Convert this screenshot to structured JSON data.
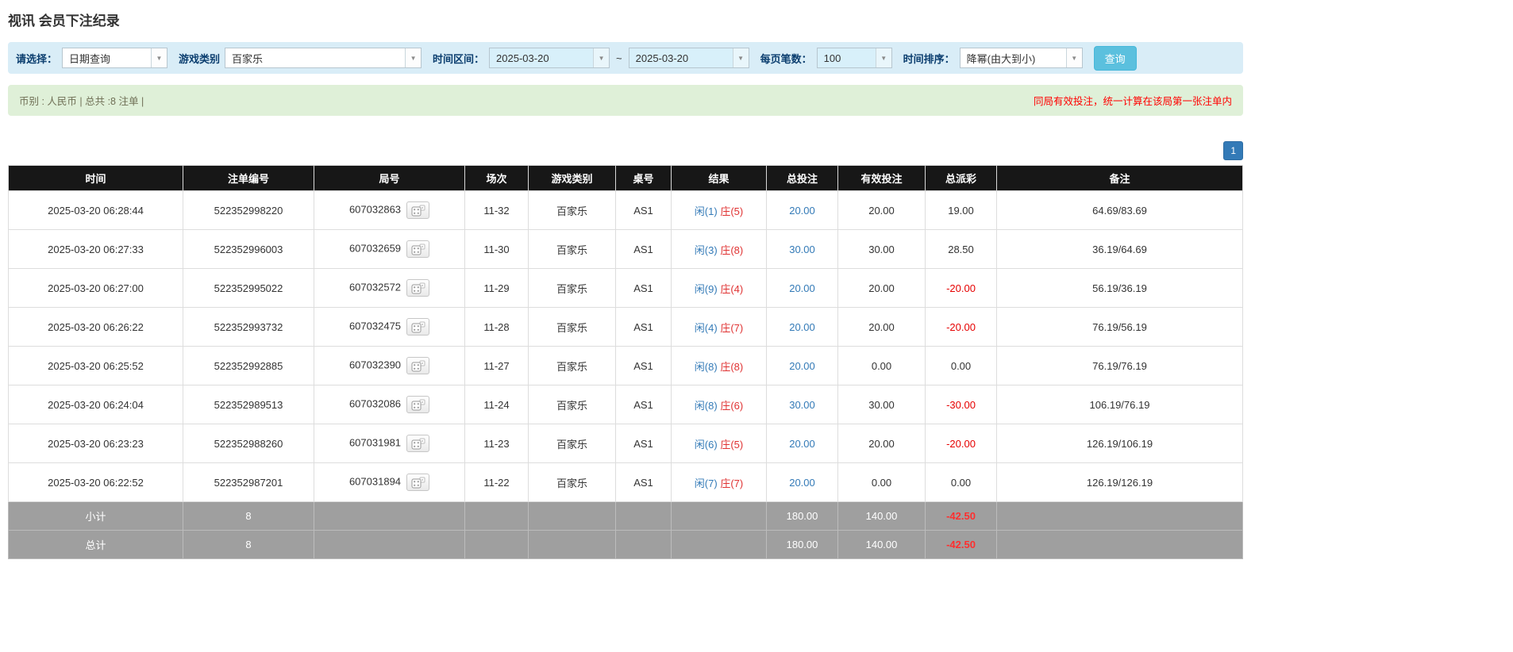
{
  "page": {
    "title": "视讯 会员下注纪录"
  },
  "filters": {
    "select_label": "请选择：",
    "select_value": "日期查询",
    "game_type_label": "游戏类别",
    "game_type_value": "百家乐",
    "date_range_label": "时间区间：",
    "date_from": "2025-03-20",
    "date_separator": "~",
    "date_to": "2025-03-20",
    "page_size_label": "每页笔数：",
    "page_size_value": "100",
    "sort_label": "时间排序：",
    "sort_value": "降幂(由大到小)",
    "search_button": "查询"
  },
  "info_bar": {
    "left": "币别 : 人民币 | 总共 :8 注单 |",
    "right": "同局有效投注，统一计算在该局第一张注单内"
  },
  "pagination": {
    "current": "1"
  },
  "icons": {
    "combo_arrow": "chevron-down-icon",
    "round_detail": "dice-icon"
  },
  "colors": {
    "accent_blue": "#337ab7",
    "player_blue": "#337ab7",
    "banker_red": "#e03333",
    "negative_red": "#e60000",
    "filter_bar_bg": "#d9edf7",
    "info_bar_bg": "#dff0d8",
    "table_header_bg": "#171717",
    "summary_row_bg": "#9f9f9f",
    "search_button_bg": "#5bc0de"
  },
  "table": {
    "headers": [
      "时间",
      "注单编号",
      "局号",
      "场次",
      "游戏类别",
      "桌号",
      "结果",
      "总投注",
      "有效投注",
      "总派彩",
      "备注"
    ],
    "rows": [
      {
        "time": "2025-03-20 06:28:44",
        "bet_id": "522352998220",
        "round": "607032863",
        "session": "11-32",
        "game": "百家乐",
        "table_no": "AS1",
        "result_player": "闲(1)",
        "result_banker": "庄(5)",
        "total_bet": "20.00",
        "valid_bet": "20.00",
        "payout": "19.00",
        "note": "64.69/83.69"
      },
      {
        "time": "2025-03-20 06:27:33",
        "bet_id": "522352996003",
        "round": "607032659",
        "session": "11-30",
        "game": "百家乐",
        "table_no": "AS1",
        "result_player": "闲(3)",
        "result_banker": "庄(8)",
        "total_bet": "30.00",
        "valid_bet": "30.00",
        "payout": "28.50",
        "note": "36.19/64.69"
      },
      {
        "time": "2025-03-20 06:27:00",
        "bet_id": "522352995022",
        "round": "607032572",
        "session": "11-29",
        "game": "百家乐",
        "table_no": "AS1",
        "result_player": "闲(9)",
        "result_banker": "庄(4)",
        "total_bet": "20.00",
        "valid_bet": "20.00",
        "payout": "-20.00",
        "note": "56.19/36.19"
      },
      {
        "time": "2025-03-20 06:26:22",
        "bet_id": "522352993732",
        "round": "607032475",
        "session": "11-28",
        "game": "百家乐",
        "table_no": "AS1",
        "result_player": "闲(4)",
        "result_banker": "庄(7)",
        "total_bet": "20.00",
        "valid_bet": "20.00",
        "payout": "-20.00",
        "note": "76.19/56.19"
      },
      {
        "time": "2025-03-20 06:25:52",
        "bet_id": "522352992885",
        "round": "607032390",
        "session": "11-27",
        "game": "百家乐",
        "table_no": "AS1",
        "result_player": "闲(8)",
        "result_banker": "庄(8)",
        "total_bet": "20.00",
        "valid_bet": "0.00",
        "payout": "0.00",
        "note": "76.19/76.19"
      },
      {
        "time": "2025-03-20 06:24:04",
        "bet_id": "522352989513",
        "round": "607032086",
        "session": "11-24",
        "game": "百家乐",
        "table_no": "AS1",
        "result_player": "闲(8)",
        "result_banker": "庄(6)",
        "total_bet": "30.00",
        "valid_bet": "30.00",
        "payout": "-30.00",
        "note": "106.19/76.19"
      },
      {
        "time": "2025-03-20 06:23:23",
        "bet_id": "522352988260",
        "round": "607031981",
        "session": "11-23",
        "game": "百家乐",
        "table_no": "AS1",
        "result_player": "闲(6)",
        "result_banker": "庄(5)",
        "total_bet": "20.00",
        "valid_bet": "20.00",
        "payout": "-20.00",
        "note": "126.19/106.19"
      },
      {
        "time": "2025-03-20 06:22:52",
        "bet_id": "522352987201",
        "round": "607031894",
        "session": "11-22",
        "game": "百家乐",
        "table_no": "AS1",
        "result_player": "闲(7)",
        "result_banker": "庄(7)",
        "total_bet": "20.00",
        "valid_bet": "0.00",
        "payout": "0.00",
        "note": "126.19/126.19"
      }
    ],
    "subtotal": {
      "label": "小计",
      "count": "8",
      "total_bet": "180.00",
      "valid_bet": "140.00",
      "payout": "-42.50",
      "note": ""
    },
    "total": {
      "label": "总计",
      "count": "8",
      "total_bet": "180.00",
      "valid_bet": "140.00",
      "payout": "-42.50",
      "note": ""
    }
  }
}
